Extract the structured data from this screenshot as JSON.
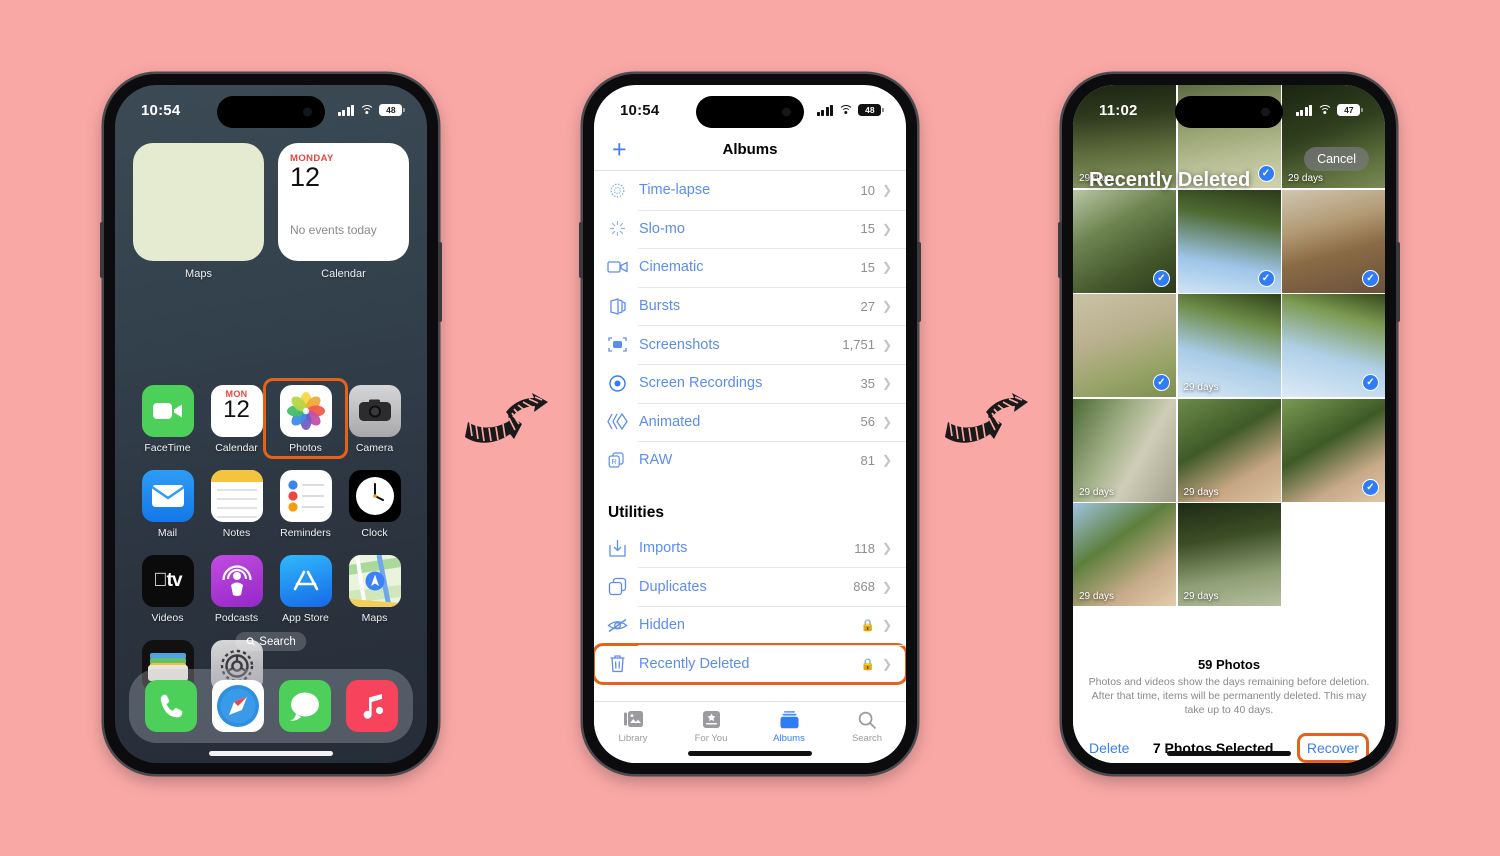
{
  "page": {
    "background_color": "#FAA8A6",
    "highlight_color": "#E2631A",
    "accent_blue": "#3B7EF6"
  },
  "phone1": {
    "name": "iPhone Home Screen",
    "status": {
      "time": "10:54",
      "battery": "48",
      "signal_icon": "cellular-bars-icon",
      "wifi_icon": "wifi-icon"
    },
    "widgets": [
      {
        "id": "maps",
        "label": "Maps",
        "type": "blank-map"
      },
      {
        "id": "calendar",
        "label": "Calendar",
        "dow": "MONDAY",
        "day": "12",
        "note": "No events today"
      }
    ],
    "apps": [
      {
        "label": "FaceTime",
        "icon": "facetime-icon",
        "highlighted": false
      },
      {
        "label": "Calendar",
        "icon": "calendar-icon",
        "dow": "MON",
        "day": "12",
        "highlighted": false
      },
      {
        "label": "Photos",
        "icon": "photos-icon",
        "highlighted": true
      },
      {
        "label": "Camera",
        "icon": "camera-icon",
        "highlighted": false
      },
      {
        "label": "Mail",
        "icon": "mail-icon",
        "highlighted": false
      },
      {
        "label": "Notes",
        "icon": "notes-icon",
        "highlighted": false
      },
      {
        "label": "Reminders",
        "icon": "reminders-icon",
        "highlighted": false
      },
      {
        "label": "Clock",
        "icon": "clock-icon",
        "highlighted": false
      },
      {
        "label": "Videos",
        "icon": "appletv-icon",
        "highlighted": false
      },
      {
        "label": "Podcasts",
        "icon": "podcasts-icon",
        "highlighted": false
      },
      {
        "label": "App Store",
        "icon": "appstore-icon",
        "highlighted": false
      },
      {
        "label": "Maps",
        "icon": "maps-icon",
        "highlighted": false
      },
      {
        "label": "Wallet",
        "icon": "wallet-icon",
        "highlighted": false
      },
      {
        "label": "Settings",
        "icon": "settings-icon",
        "highlighted": false
      }
    ],
    "search_pill": {
      "label": "Search",
      "icon": "search-icon"
    },
    "dock": [
      {
        "label": "Phone",
        "icon": "phone-icon"
      },
      {
        "label": "Safari",
        "icon": "safari-icon"
      },
      {
        "label": "Messages",
        "icon": "messages-icon"
      },
      {
        "label": "Music",
        "icon": "music-icon"
      }
    ]
  },
  "phone2": {
    "name": "Photos Albums",
    "status": {
      "time": "10:54",
      "battery": "48"
    },
    "nav": {
      "title": "Albums",
      "add_icon": "plus-icon"
    },
    "media_types": [
      {
        "name": "Time-lapse",
        "count": "10",
        "icon": "timelapse-icon",
        "highlighted": false
      },
      {
        "name": "Slo-mo",
        "count": "15",
        "icon": "slomo-icon",
        "highlighted": false
      },
      {
        "name": "Cinematic",
        "count": "15",
        "icon": "cinematic-icon",
        "highlighted": false
      },
      {
        "name": "Bursts",
        "count": "27",
        "icon": "bursts-icon",
        "highlighted": false
      },
      {
        "name": "Screenshots",
        "count": "1,751",
        "icon": "screenshots-icon",
        "highlighted": false
      },
      {
        "name": "Screen Recordings",
        "count": "35",
        "icon": "screen-recordings-icon",
        "highlighted": false
      },
      {
        "name": "Animated",
        "count": "56",
        "icon": "animated-icon",
        "highlighted": false
      },
      {
        "name": "RAW",
        "count": "81",
        "icon": "raw-icon",
        "highlighted": false
      }
    ],
    "utilities_header": "Utilities",
    "utilities": [
      {
        "name": "Imports",
        "count": "118",
        "icon": "imports-icon",
        "locked": false,
        "highlighted": false
      },
      {
        "name": "Duplicates",
        "count": "868",
        "icon": "duplicates-icon",
        "locked": false,
        "highlighted": false
      },
      {
        "name": "Hidden",
        "count": "",
        "icon": "hidden-eye-icon",
        "locked": true,
        "highlighted": false
      },
      {
        "name": "Recently Deleted",
        "count": "",
        "icon": "trash-icon",
        "locked": true,
        "highlighted": true
      }
    ],
    "tabs": [
      {
        "label": "Library",
        "icon": "library-icon",
        "active": false
      },
      {
        "label": "For You",
        "icon": "for-you-icon",
        "active": false
      },
      {
        "label": "Albums",
        "icon": "albums-icon",
        "active": true
      },
      {
        "label": "Search",
        "icon": "search-icon",
        "active": false
      }
    ]
  },
  "phone3": {
    "name": "Recently Deleted",
    "status": {
      "time": "11:02",
      "battery": "47"
    },
    "title": "Recently Deleted",
    "cancel_label": "Cancel",
    "photos": [
      {
        "days": "29 days",
        "selected": false,
        "art": "forest-dark"
      },
      {
        "days": "",
        "selected": true,
        "art": "forest-pale"
      },
      {
        "days": "29 days",
        "selected": false,
        "art": "forest-trunk"
      },
      {
        "days": "",
        "selected": true,
        "art": "forest-green"
      },
      {
        "days": "",
        "selected": true,
        "art": "canopy-sky"
      },
      {
        "days": "",
        "selected": true,
        "art": "cows"
      },
      {
        "days": "",
        "selected": true,
        "art": "leaves-sand"
      },
      {
        "days": "29 days",
        "selected": false,
        "art": "gum-sky"
      },
      {
        "days": "",
        "selected": true,
        "art": "gum-sky2"
      },
      {
        "days": "29 days",
        "selected": false,
        "art": "bark-trunk"
      },
      {
        "days": "29 days",
        "selected": false,
        "art": "gum-forks"
      },
      {
        "days": "",
        "selected": true,
        "art": "gum-forks2"
      },
      {
        "days": "29 days",
        "selected": false,
        "art": "gum-forks3"
      },
      {
        "days": "29 days",
        "selected": false,
        "art": "dark-branches"
      }
    ],
    "footer": {
      "count": "59 Photos",
      "description": "Photos and videos show the days remaining before deletion. After that time, items will be permanently deleted. This may take up to 40 days.",
      "delete_label": "Delete",
      "selected_label": "7 Photos Selected",
      "recover_label": "Recover"
    }
  },
  "arrows": [
    {
      "id": "arrow-1-to-2",
      "direction": "right"
    },
    {
      "id": "arrow-2-to-3",
      "direction": "right"
    }
  ]
}
